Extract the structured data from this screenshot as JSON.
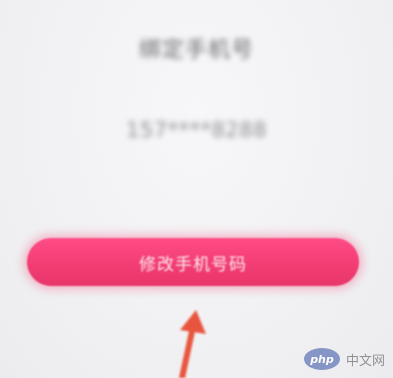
{
  "screen": {
    "bound_title": "绑定手机号",
    "bound_phone": "157****8288"
  },
  "action": {
    "change_phone_label": "修改手机号码",
    "accent_color": "#f13d72"
  },
  "annotation": {
    "arrow_color": "#e8553e",
    "icon": "arrow-up-icon"
  },
  "watermark": {
    "logo_text": "php",
    "site_text": "中文网"
  }
}
